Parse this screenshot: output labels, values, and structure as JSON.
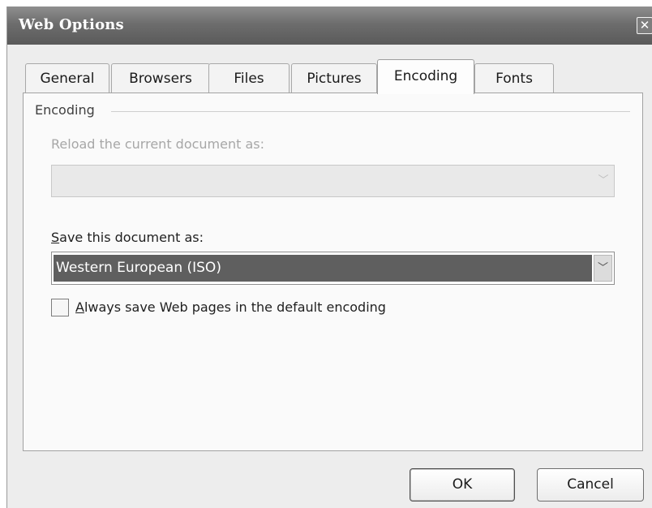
{
  "window": {
    "title": "Web Options",
    "close_glyph": "✕"
  },
  "tabs": [
    {
      "label": "General"
    },
    {
      "label": "Browsers"
    },
    {
      "label": "Files"
    },
    {
      "label": "Pictures"
    },
    {
      "label": "Encoding",
      "active": true
    },
    {
      "label": "Fonts"
    }
  ],
  "encoding": {
    "group_label": "Encoding",
    "reload_label": "Reload the current document as:",
    "reload_value": "",
    "save_label_prefix": "",
    "save_label_accesskey": "S",
    "save_label_rest": "ave this document as:",
    "save_value": "Western European (ISO)",
    "always_save_accesskey": "A",
    "always_save_rest": "lways save Web pages in the default encoding",
    "always_save_checked": false
  },
  "buttons": {
    "ok": "OK",
    "cancel": "Cancel"
  },
  "icons": {
    "dropdown_arrow": "chevron-down-icon",
    "dropdown_glyph": "﹀"
  }
}
